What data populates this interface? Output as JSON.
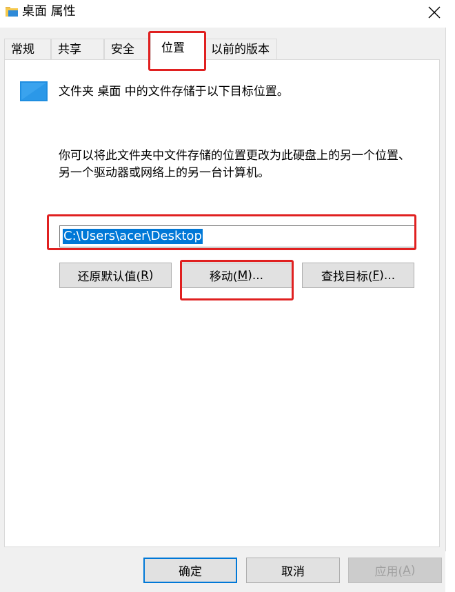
{
  "window": {
    "title": "桌面 属性",
    "icon": "folder-icon"
  },
  "tabs": [
    {
      "label": "常规"
    },
    {
      "label": "共享"
    },
    {
      "label": "安全"
    },
    {
      "label": "位置",
      "active": true
    },
    {
      "label": "以前的版本"
    }
  ],
  "location": {
    "info_text": "文件夹 桌面 中的文件存储于以下目标位置。",
    "description": "你可以将此文件夹中文件存储的位置更改为此硬盘上的另一个位置、另一个驱动器或网络上的另一台计算机。",
    "path_value": "C:\\Users\\acer\\Desktop",
    "restore_default": {
      "label": "还原默认值(",
      "mnemonic": "R",
      "suffix": ")"
    },
    "move": {
      "label": "移动(",
      "mnemonic": "M",
      "suffix": ")..."
    },
    "find_target": {
      "label": "查找目标(",
      "mnemonic": "F",
      "suffix": ")..."
    }
  },
  "footer": {
    "ok_label": "确定",
    "cancel_label": "取消",
    "apply": {
      "label": "应用(",
      "mnemonic": "A",
      "suffix": ")",
      "disabled": true
    }
  },
  "colors": {
    "highlight": "#e02020",
    "selection": "#0078d7",
    "accent": "#0078d7"
  }
}
